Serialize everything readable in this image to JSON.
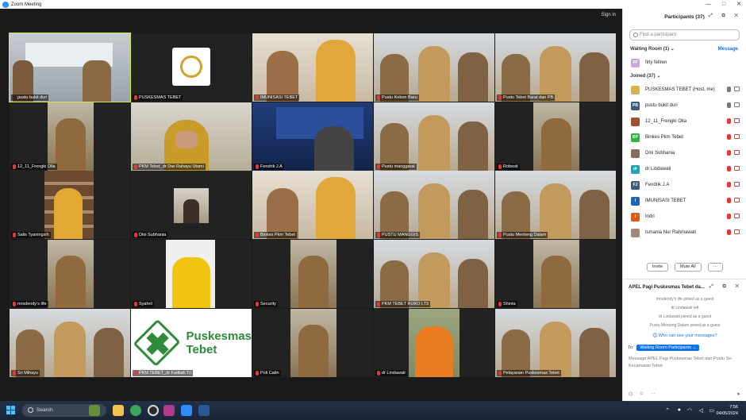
{
  "window": {
    "title": "Zoom Meeting",
    "controls": [
      "—",
      "□",
      "✕"
    ]
  },
  "signin": "Sign in",
  "tiles": [
    {
      "name": "pustu bukit duri",
      "active": true,
      "scene": "office",
      "muted": false
    },
    {
      "name": "PUSKESMAS TEBET",
      "scene": "logo",
      "muted": true
    },
    {
      "name": "IMUNISASI TEBET",
      "scene": "salute",
      "muted": true
    },
    {
      "name": "Pustu Kebon Baru",
      "scene": "group",
      "muted": true
    },
    {
      "name": "Pustu Tebet Barat dan PB",
      "scene": "group",
      "muted": true
    },
    {
      "name": "12_11_Frengki Olla",
      "scene": "single",
      "muted": true
    },
    {
      "name": "PKM Tebet_dr Dwi Rahayu Utami",
      "scene": "hijab",
      "muted": true
    },
    {
      "name": "Fendrik J.A",
      "scene": "presentation",
      "muted": true
    },
    {
      "name": "Pustu manggarai",
      "scene": "group",
      "muted": true
    },
    {
      "name": "Robesti",
      "scene": "single",
      "muted": true
    },
    {
      "name": "Salis Tyaningsih",
      "scene": "shelf",
      "muted": true
    },
    {
      "name": "Dini Subhania",
      "scene": "small",
      "muted": true
    },
    {
      "name": "Binkes Pkm Tebet",
      "scene": "salute",
      "muted": true
    },
    {
      "name": "PUSTU MANGGIS",
      "scene": "group",
      "muted": true
    },
    {
      "name": "Pustu Menteng Dalam",
      "scene": "group",
      "muted": true
    },
    {
      "name": "mrsdendy's life",
      "scene": "single",
      "muted": true
    },
    {
      "name": "Syahril",
      "scene": "yellow",
      "muted": true
    },
    {
      "name": "Security",
      "scene": "single",
      "muted": true
    },
    {
      "name": "PKM TEBET RUKO LT3",
      "scene": "group",
      "muted": true
    },
    {
      "name": "Shinta",
      "scene": "single",
      "muted": true
    },
    {
      "name": "Sri Mihayu",
      "scene": "group",
      "muted": true
    },
    {
      "name": "PKM TEBET_dr Fadilah Tri",
      "scene": "bigLogo",
      "muted": true
    },
    {
      "name": "Poli Catin",
      "scene": "single",
      "muted": true
    },
    {
      "name": "dr Lindawati",
      "scene": "orange",
      "muted": true
    },
    {
      "name": "Pelayanan Puskesmas Tebet",
      "scene": "group",
      "muted": true
    }
  ],
  "logo_text": {
    "line1": "Puskesmas",
    "line2": "Tebet"
  },
  "participants": {
    "header": "Participants (37)",
    "search_placeholder": "Find a participant",
    "waiting_header": "Waiting Room (1)",
    "message_label": "Message",
    "waiting": [
      {
        "name": "firly fellren",
        "initials": "FF",
        "color": "#c9a7d9"
      }
    ],
    "joined_header": "Joined (37)",
    "list": [
      {
        "name": "PUSKESMAS TEBET (Host, me)",
        "initials": "",
        "color": "#d4b44a",
        "mic": "on"
      },
      {
        "name": "pustu bukit duri",
        "initials": "PB",
        "color": "#3d5a80",
        "mic": "on"
      },
      {
        "name": "12_11_Frengki Olla",
        "initials": "",
        "color": "#a0522d",
        "mic": "off"
      },
      {
        "name": "Binkes Pkm Tebet",
        "initials": "BP",
        "color": "#2fb344",
        "mic": "off"
      },
      {
        "name": "Dini Subhania",
        "initials": "",
        "color": "#8b6c5c",
        "mic": "off"
      },
      {
        "name": "dr Lindawati",
        "initials": "dr",
        "color": "#1aa6b7",
        "mic": "off"
      },
      {
        "name": "Fendrik J.A",
        "initials": "FJ",
        "color": "#3d5a80",
        "mic": "off"
      },
      {
        "name": "IMUNISASI TEBET",
        "initials": "I",
        "color": "#1565c0",
        "mic": "off"
      },
      {
        "name": "Indri",
        "initials": "I",
        "color": "#e8590c",
        "mic": "off"
      },
      {
        "name": "Ismania Nur Rahmawati",
        "initials": "",
        "color": "#9e8a7a",
        "mic": "off"
      }
    ],
    "invite_label": "Invite",
    "mute_all_label": "Mute All",
    "more_label": "···"
  },
  "chat": {
    "title": "APEL Pagi Puskesmas Tebet da...",
    "lines": [
      "mrsdendy's life joined as a guest",
      "dr Lindawati left",
      "dr Lindawati joined as a guest",
      "Pustu Menteng Dalam joined as a guest"
    ],
    "who_can_see": "Who can see your messages?",
    "to_label": "To:",
    "to_value": "Waiting Room Participants",
    "input_placeholder": "Message APEL Pagi Puskesmas Tebet dan Pustu Se-Kecamatan Tebet"
  },
  "taskbar": {
    "search_label": "Search",
    "time": "7:56",
    "date": "04/05/2024"
  }
}
